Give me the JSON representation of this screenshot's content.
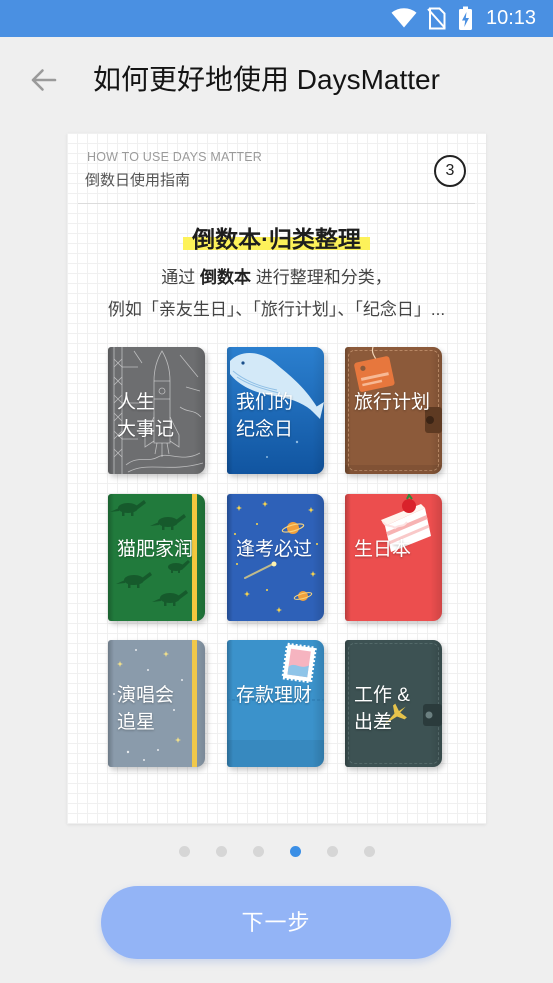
{
  "colors": {
    "status_bar": "#4a90e2",
    "accent": "#3b8fe6",
    "button": "#93b4f6",
    "highlight": "#fdf25a"
  },
  "status_bar": {
    "time": "10:13",
    "icons": [
      "wifi-icon",
      "no-sim-icon",
      "battery-charging-icon"
    ]
  },
  "header": {
    "back_icon": "back-arrow-icon",
    "title": "如何更好地使用 DaysMatter"
  },
  "guide": {
    "eyebrow": "HOW TO USE DAYS MATTER",
    "subtitle": "倒数日使用指南",
    "step": "3",
    "heading": "倒数本·归类整理",
    "description": {
      "line1_prefix": "通过 ",
      "line1_bold": "倒数本",
      "line1_suffix": " 进行整理和分类，",
      "line2": "例如「亲友生日」、「旅行计划」、「纪念日」..."
    }
  },
  "notebooks": [
    {
      "lines": [
        "人生",
        "大事记"
      ],
      "color": "#6d6e70"
    },
    {
      "lines": [
        "我们的",
        "纪念日"
      ],
      "color": "#1a6cc0"
    },
    {
      "lines": [
        "旅行计划"
      ],
      "color": "#8c5a3a"
    },
    {
      "lines": [
        "猫肥家润"
      ],
      "color": "#217a3c"
    },
    {
      "lines": [
        "逢考必过"
      ],
      "color": "#2e61b8"
    },
    {
      "lines": [
        "生日本"
      ],
      "color": "#ec4e4e"
    },
    {
      "lines": [
        "演唱会",
        "追星"
      ],
      "color": "#8a9bab"
    },
    {
      "lines": [
        "存款理财"
      ],
      "color": "#3b92cb"
    },
    {
      "lines": [
        "工作 &",
        "出差"
      ],
      "color": "#3d5253"
    }
  ],
  "pagination": {
    "total": 6,
    "active": 3
  },
  "footer": {
    "next_label": "下一步"
  }
}
